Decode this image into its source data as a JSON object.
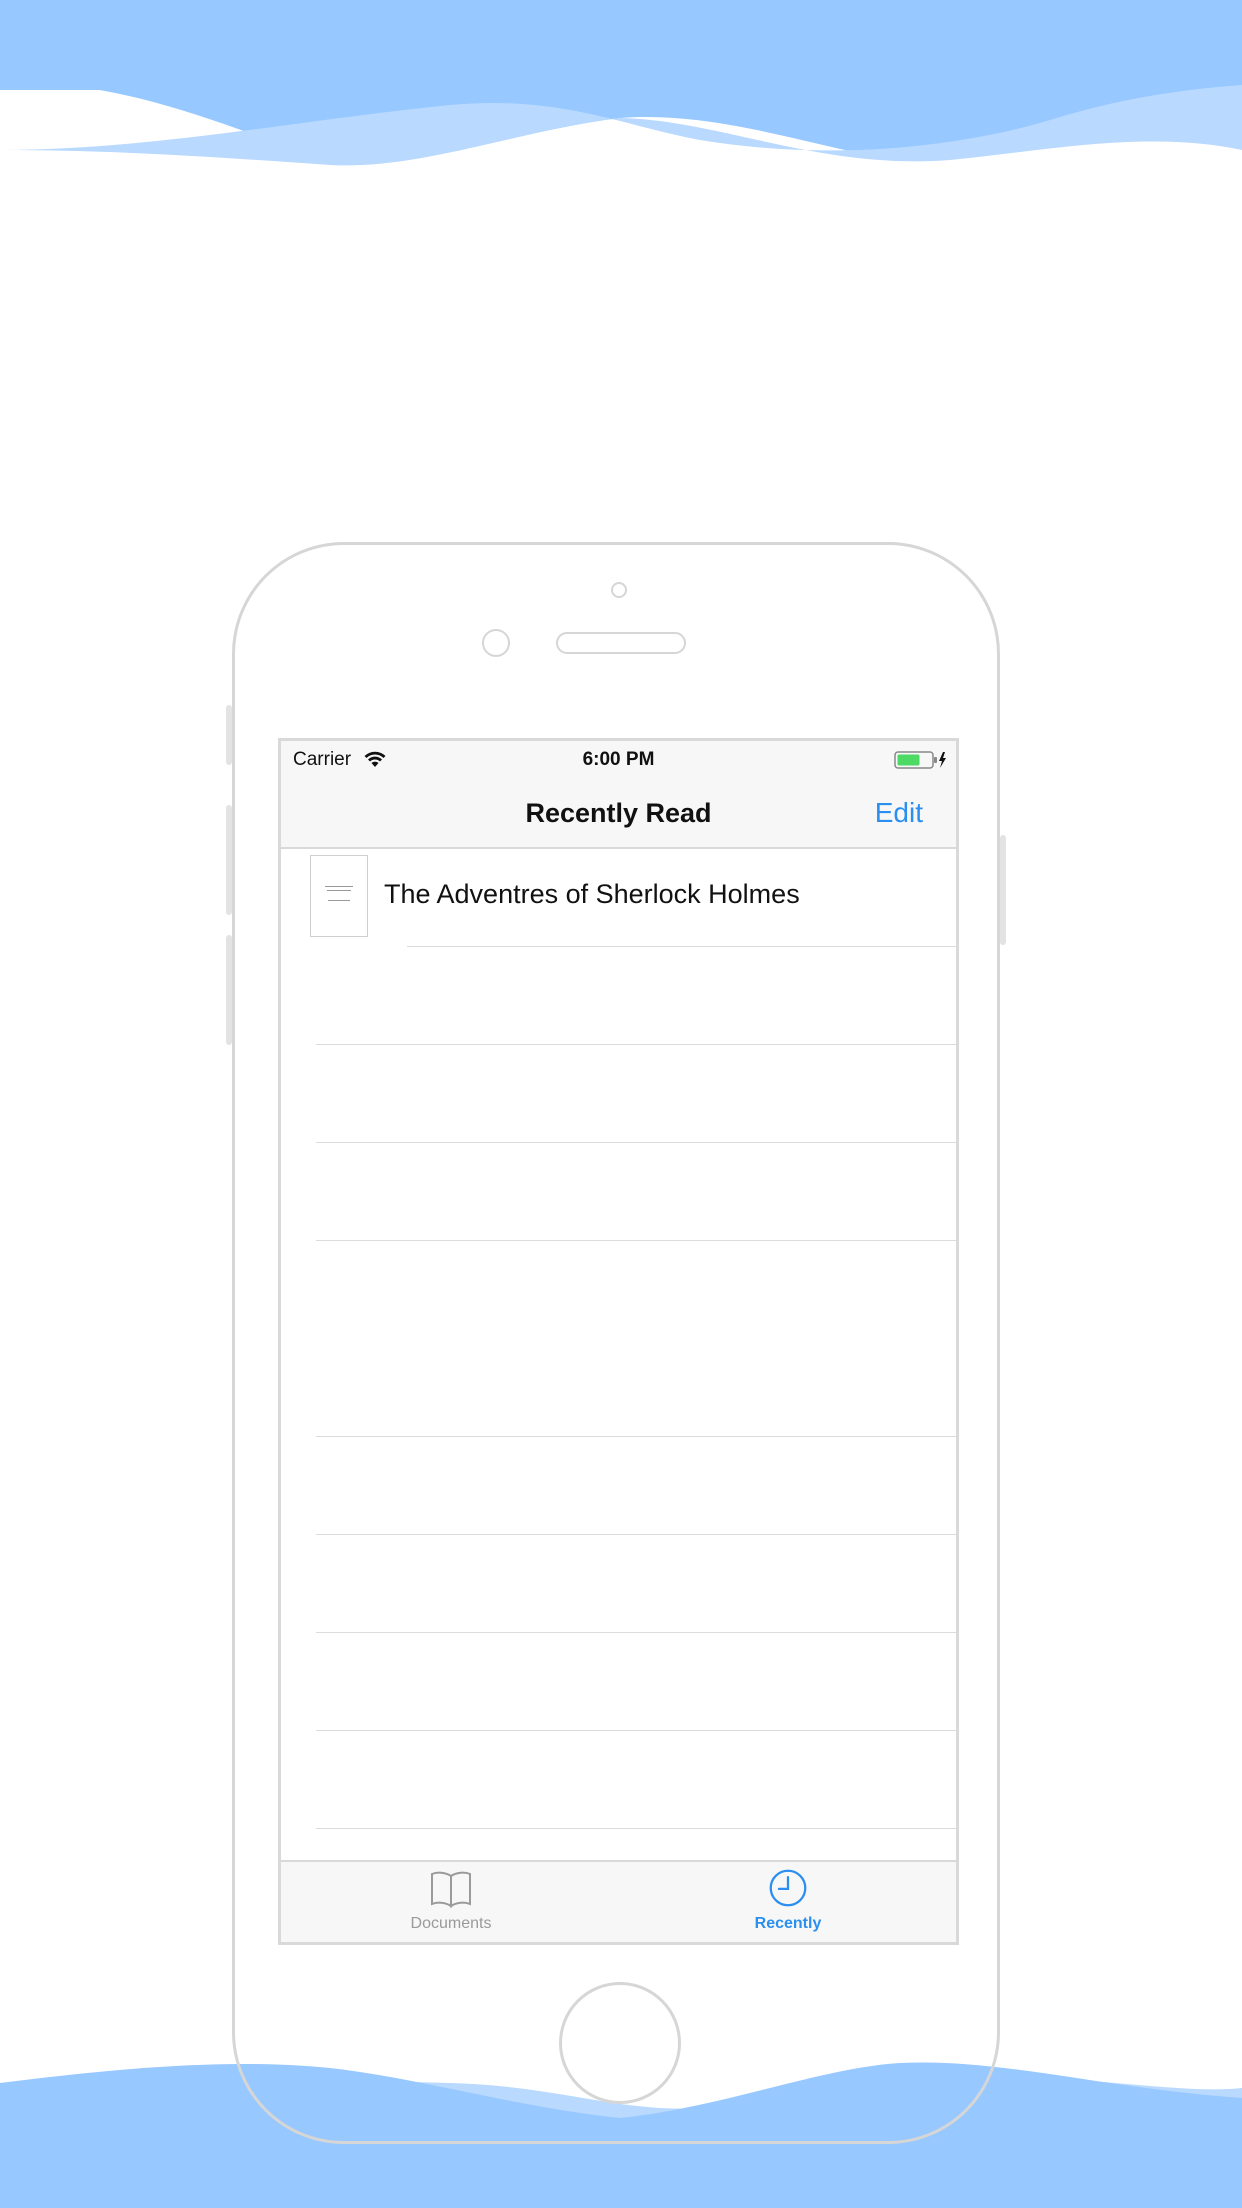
{
  "status_bar": {
    "carrier": "Carrier",
    "time": "6:00 PM",
    "wifi_icon": "wifi-icon",
    "battery_icon": "battery-charging-icon"
  },
  "nav": {
    "title": "Recently Read",
    "edit_label": "Edit"
  },
  "recent_items": [
    {
      "title": "The Adventres of Sherlock Holmes",
      "thumbnail_icon": "document-thumbnail"
    }
  ],
  "tabs": [
    {
      "label": "Documents",
      "icon": "book-icon",
      "selected": false
    },
    {
      "label": "Recently",
      "icon": "clock-icon",
      "selected": true
    }
  ],
  "colors": {
    "accent": "#2b8ff0",
    "wave": "#97c8ff",
    "wave_light": "#b9d9ff",
    "inactive": "#9a9a9a"
  }
}
